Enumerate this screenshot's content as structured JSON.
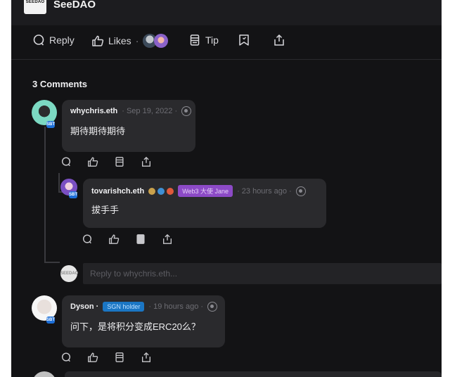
{
  "header": {
    "logo_text": "SEEDAO",
    "brand": "SeeDAO"
  },
  "actions": {
    "reply_label": "Reply",
    "likes_label": "Likes",
    "likes_dot": "·",
    "tip_label": "Tip"
  },
  "comments_count": "3 Comments",
  "comments": [
    {
      "author": "whychris.eth",
      "time": "· Sep 19, 2022 ·",
      "text": "期待期待期待",
      "badge": "SBT"
    },
    {
      "author": "tovarishch.eth",
      "tag": "Web3 大使 Jane",
      "time": "· 23 hours ago ·",
      "text": "拔手手",
      "badge": "SBT"
    },
    {
      "author": "Dyson ·",
      "tag": "SGN holder",
      "time": "· 19 hours ago ·",
      "text": "问下，是将积分变成ERC20么？",
      "badge": "SBT"
    }
  ],
  "reply_box": {
    "placeholder": "Reply to whychris.eth...",
    "avatar_text": "SEEDAO"
  },
  "colors": {
    "background": "#131315",
    "bubble": "#2a2a2d",
    "tag_purple": "#8c4ac6",
    "tag_blue": "#1b76c4"
  }
}
